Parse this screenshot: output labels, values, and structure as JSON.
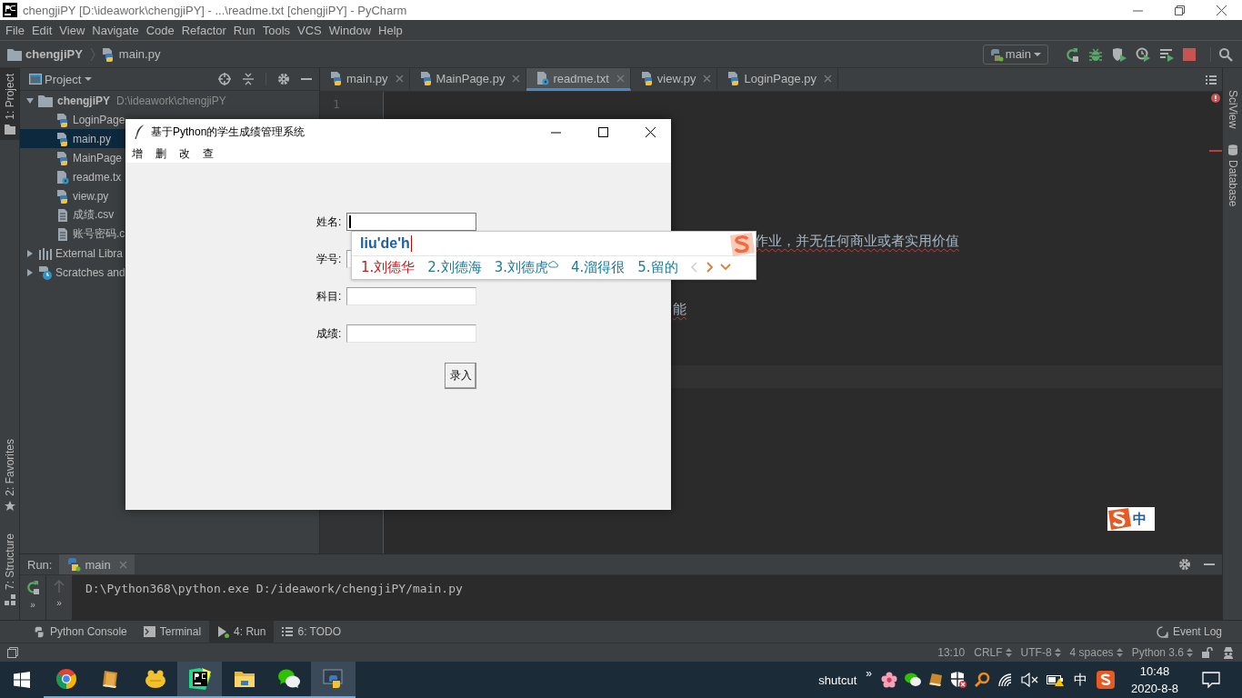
{
  "window": {
    "title": "chengjiPY [D:\\ideawork\\chengjiPY] - ...\\readme.txt [chengjiPY] - PyCharm"
  },
  "menu": [
    "File",
    "Edit",
    "View",
    "Navigate",
    "Code",
    "Refactor",
    "Run",
    "Tools",
    "VCS",
    "Window",
    "Help"
  ],
  "breadcrumb": [
    "chengjiPY",
    "main.py"
  ],
  "run_config": {
    "label": "main"
  },
  "left_stripe": {
    "top": [
      {
        "label": "1: Project",
        "selected": true
      }
    ],
    "bottom": [
      {
        "label": "2: Favorites",
        "kind": "favorites"
      },
      {
        "label": "7: Structure",
        "kind": "structure"
      }
    ]
  },
  "right_stripe": [
    {
      "label": "SciView",
      "kind": "sciview"
    },
    {
      "label": "Database",
      "kind": "database"
    }
  ],
  "project_panel": {
    "title": "Project",
    "tree": [
      {
        "label": "chengjiPY",
        "path": "D:\\ideawork\\chengjiPY",
        "kind": "folder",
        "expanded": true,
        "selected": false,
        "children": [
          {
            "label": "LoginPage",
            "kind": "python",
            "selected": false
          },
          {
            "label": "main.py",
            "kind": "python",
            "selected": true
          },
          {
            "label": "MainPage",
            "kind": "python",
            "selected": false
          },
          {
            "label": "readme.tx",
            "kind": "text",
            "selected": false
          },
          {
            "label": "view.py",
            "kind": "python",
            "selected": false
          },
          {
            "label": "成绩.csv",
            "kind": "csv",
            "selected": false
          },
          {
            "label": "账号密码.c",
            "kind": "csv",
            "selected": false
          }
        ]
      },
      {
        "label": "External Libra",
        "kind": "library",
        "expanded": false,
        "selected": false
      },
      {
        "label": "Scratches and",
        "kind": "scratch",
        "expanded": false,
        "selected": false
      }
    ]
  },
  "editor": {
    "tabs": [
      {
        "label": "main.py",
        "kind": "python",
        "selected": false
      },
      {
        "label": "MainPage.py",
        "kind": "python",
        "selected": false
      },
      {
        "label": "readme.txt",
        "kind": "text",
        "selected": true
      },
      {
        "label": "view.py",
        "kind": "python",
        "selected": false
      },
      {
        "label": "LoginPage.py",
        "kind": "python",
        "selected": false
      }
    ],
    "line_number": "1",
    "visible_text": [
      {
        "text": "作业，并无任何商业或者实用价值",
        "spell_error": true
      },
      {
        "text": "能",
        "spell_error": true
      }
    ]
  },
  "run_panel": {
    "label": "Run:",
    "tabs": [
      {
        "label": "main",
        "selected": true
      }
    ],
    "more": [
      "»",
      "»"
    ],
    "output": "D:\\Python368\\python.exe D:/ideawork/chengjiPY/main.py"
  },
  "tool_windows": [
    {
      "label": "Python Console",
      "kind": "python",
      "selected": false
    },
    {
      "label": "Terminal",
      "kind": "terminal",
      "selected": false
    },
    {
      "label": "4: Run",
      "kind": "run",
      "selected": true
    },
    {
      "label": "6: TODO",
      "kind": "todo",
      "selected": false
    }
  ],
  "event_log": "Event Log",
  "status_bar": [
    "13:10",
    "CRLF",
    "UTF-8",
    "4 spaces",
    "Python 3.6"
  ],
  "app_window": {
    "title": "基于Python的学生成绩管理系统",
    "menu": [
      "增",
      "删",
      "改",
      "查"
    ],
    "fields": [
      {
        "label": "姓名:",
        "focused": true
      },
      {
        "label": "学号:"
      },
      {
        "label": "科目:",
        "focused": false
      },
      {
        "label": "成绩:",
        "focused": false
      }
    ],
    "button": "录入"
  },
  "ime_popup": {
    "composition": "liu'de'h",
    "candidates": [
      {
        "label": "1.刘德华",
        "selected": true,
        "cloud": false
      },
      {
        "label": "2.刘德海",
        "selected": false,
        "cloud": false
      },
      {
        "label": "3.刘德虎",
        "selected": false,
        "cloud": true
      },
      {
        "label": "4.溜得很",
        "selected": false,
        "cloud": false
      },
      {
        "label": "5.留的",
        "selected": false,
        "cloud": false
      }
    ]
  },
  "ime_status": {
    "mode": "中"
  },
  "taskbar": {
    "apps": [
      {
        "kind": "chrome",
        "active": false
      },
      {
        "kind": "book",
        "active": false
      },
      {
        "kind": "blob",
        "active": false
      },
      {
        "kind": "pycharm",
        "active": true
      },
      {
        "kind": "explorer",
        "active": false
      },
      {
        "kind": "wechat",
        "active": false
      },
      {
        "kind": "python",
        "active": true
      }
    ],
    "tray_label": "shutcut",
    "overflow": "»",
    "ime": "中",
    "time": "10:48",
    "date": "2020-8-8"
  }
}
